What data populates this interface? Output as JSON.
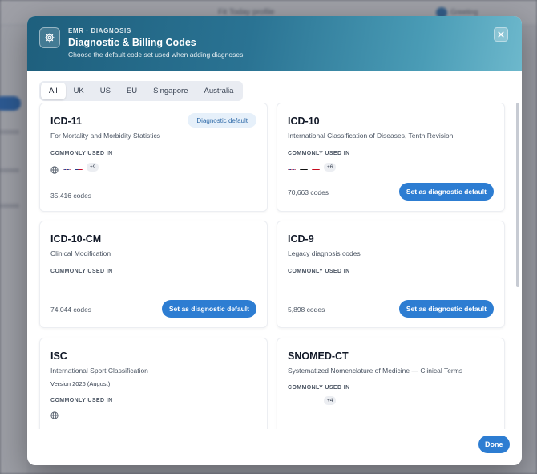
{
  "background": {
    "top_text": "Fit Today profile",
    "user_text": "Greeting"
  },
  "header": {
    "eyebrow": "EMR · DIAGNOSIS",
    "title": "Diagnostic & Billing Codes",
    "subtitle": "Choose the default code set used when adding diagnoses.",
    "icon": "gear-icon",
    "close_icon": "close-icon"
  },
  "tabs": [
    {
      "label": "All",
      "active": true
    },
    {
      "label": "UK",
      "active": false
    },
    {
      "label": "US",
      "active": false
    },
    {
      "label": "EU",
      "active": false
    },
    {
      "label": "Singapore",
      "active": false
    },
    {
      "label": "Australia",
      "active": false
    }
  ],
  "common_label": "COMMONLY USED IN",
  "cards": [
    {
      "code": "ICD-11",
      "description": "For Mortality and Morbidity Statistics",
      "flags": [
        "globe",
        "uk",
        "us"
      ],
      "more": "+9",
      "count": "35,416 codes",
      "is_default": true,
      "badge": "Diagnostic default"
    },
    {
      "code": "ICD-10",
      "description": "International Classification of Diseases, Tenth Revision",
      "flags": [
        "uk",
        "de",
        "es"
      ],
      "more": "+6",
      "count": "70,663 codes",
      "is_default": false,
      "button": "Set as diagnostic default"
    },
    {
      "code": "ICD-10-CM",
      "description": "Clinical Modification",
      "flags": [
        "us"
      ],
      "more": "",
      "count": "74,044 codes",
      "is_default": false,
      "button": "Set as diagnostic default"
    },
    {
      "code": "ICD-9",
      "description": "Legacy diagnosis codes",
      "flags": [
        "us"
      ],
      "more": "",
      "count": "5,898 codes",
      "is_default": false,
      "button": "Set as diagnostic default"
    },
    {
      "code": "ISC",
      "description": "International Sport Classification",
      "version": "Version 2026 (August)",
      "flags": [
        "globe"
      ],
      "more": ""
    },
    {
      "code": "SNOMED-CT",
      "description": "Systematized Nomenclature of Medicine — Clinical Terms",
      "flags": [
        "uk",
        "us",
        "au"
      ],
      "more": "+4"
    }
  ],
  "footer": {
    "done_label": "Done"
  },
  "colors": {
    "accent": "#2d7dd2",
    "header_start": "#1e5f7d",
    "header_end": "#6db8cc",
    "badge_bg": "#e6f0fa",
    "badge_text": "#2f6aa8"
  }
}
